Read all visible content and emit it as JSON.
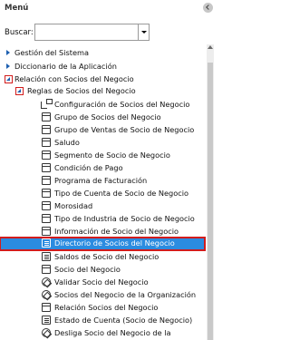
{
  "menu": {
    "title": "Menú",
    "search": {
      "label": "Buscar:",
      "value": ""
    },
    "level0": [
      "Gestión del Sistema",
      "Diccionario de la Aplicación",
      "Relación con Socios del Negocio"
    ],
    "level1": "Reglas de Socios del Negocio",
    "items": [
      "Configuración de Socios del Negocio",
      "Grupo de Socios del Negocio",
      "Grupo de Ventas de Socio de Negocio",
      "Saludo",
      "Segmento de Socio de Negocio",
      "Condición de Pago",
      "Programa de Facturación",
      "Tipo de Cuenta de Socio de Negocio",
      "Morosidad",
      "Tipo de Industria de Socio de Negocio",
      "Información de Socio del Negocio",
      "Directorio de Socios del Negocio",
      "Saldos de Socio del Negocio",
      "Socio del Negocio",
      "Validar Socio del Negocio",
      "Socios del Negocio de la Organización",
      "Relación Socios del Negocio",
      "Estado de Cuenta (Socio de Negocio)",
      "Desliga Socio del Negocio de la"
    ],
    "selected_item": "Directorio de Socios del Negocio"
  },
  "colors": {
    "selection": "#2b8ce0",
    "highlight_border": "#d21c1c",
    "expander": "#1d5fb0"
  }
}
